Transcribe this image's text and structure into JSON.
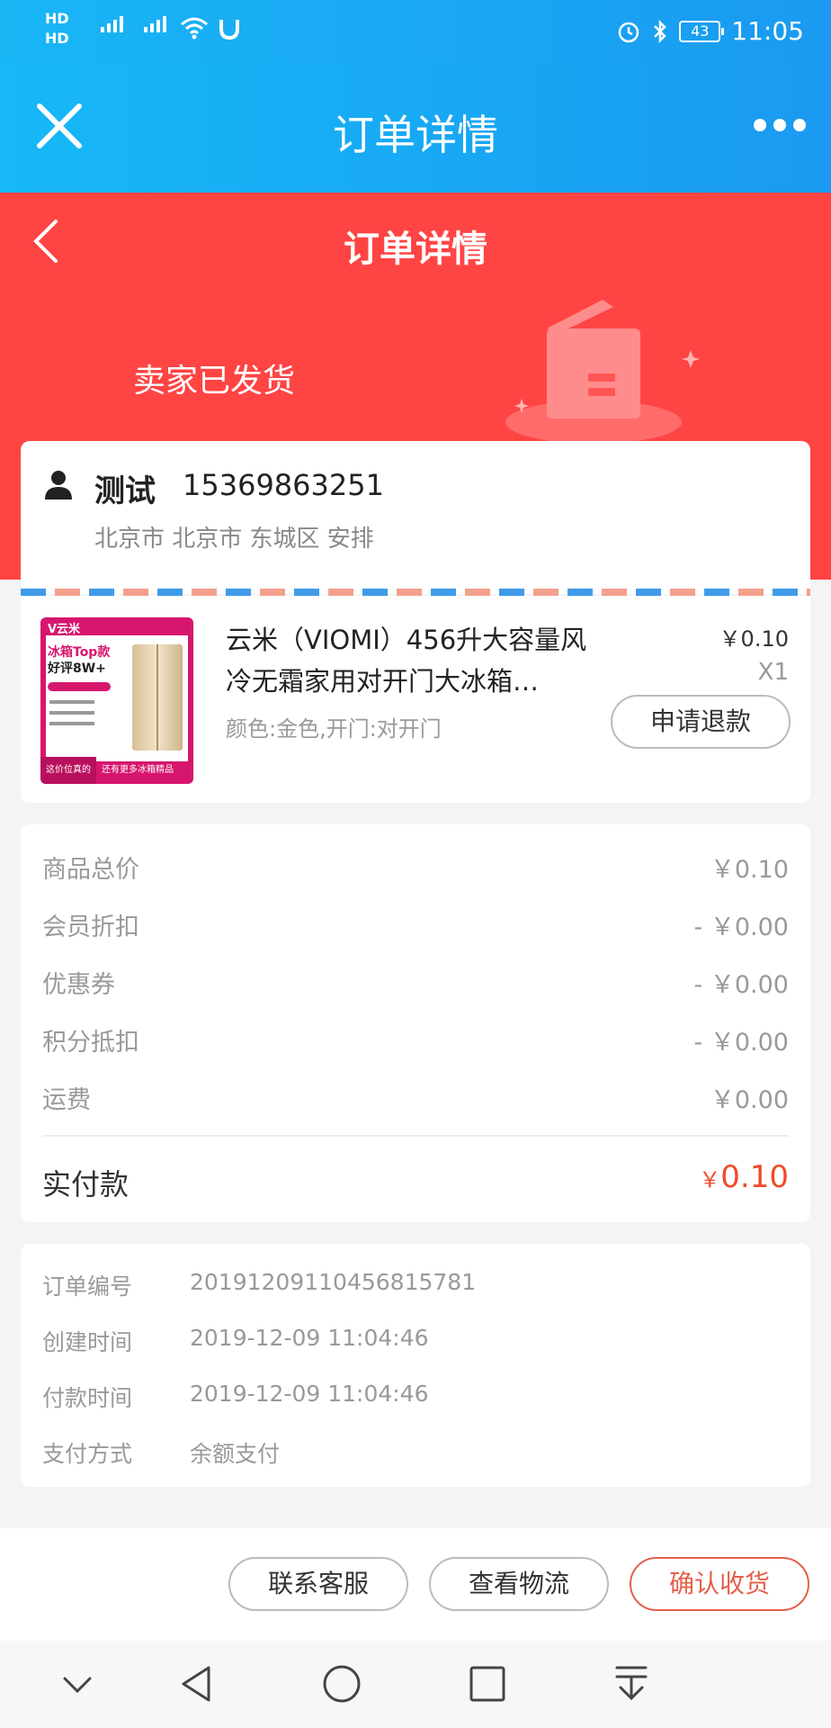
{
  "status": {
    "carrier1": "HD",
    "carrier2": "HD",
    "battery": "43",
    "time": "11:05"
  },
  "nav": {
    "title": "订单详情"
  },
  "hero": {
    "title": "订单详情",
    "status": "卖家已发货"
  },
  "address": {
    "name": "测试",
    "phone": "15369863251",
    "address": "北京市 北京市 东城区 安排"
  },
  "goods": {
    "title": "云米（VIOMI）456升大容量风冷无霜家用对开门大冰箱…",
    "spec": "颜色:金色,开门:对开门",
    "price": "￥0.10",
    "quantity": "X1",
    "refund_label": "申请退款",
    "thumb": {
      "brand": "V云米",
      "headline1": "冰箱Top款",
      "headline2": "好评8W+",
      "footer_left": "这价位真的物美价廉",
      "footer_right": "还有更多冰箱精品"
    }
  },
  "price": {
    "rows": [
      {
        "label": "商品总价",
        "value": "￥0.10"
      },
      {
        "label": "会员折扣",
        "value": "- ￥0.00"
      },
      {
        "label": "优惠券",
        "value": "- ￥0.00"
      },
      {
        "label": "积分抵扣",
        "value": "- ￥0.00"
      },
      {
        "label": "运费",
        "value": "￥0.00"
      }
    ],
    "total_label": "实付款",
    "total_currency": "￥",
    "total_value": "0.10"
  },
  "info": {
    "rows": [
      {
        "label": "订单编号",
        "value": "20191209110456815781"
      },
      {
        "label": "创建时间",
        "value": "2019-12-09 11:04:46"
      },
      {
        "label": "付款时间",
        "value": "2019-12-09 11:04:46"
      },
      {
        "label": "支付方式",
        "value": "余额支付"
      }
    ]
  },
  "actions": {
    "contact": "联系客服",
    "logistics": "查看物流",
    "confirm": "确认收货"
  },
  "colors": {
    "nav_blue": "#1a9af0",
    "hero_red": "#ff4444",
    "accent_orange": "#e4604a"
  }
}
